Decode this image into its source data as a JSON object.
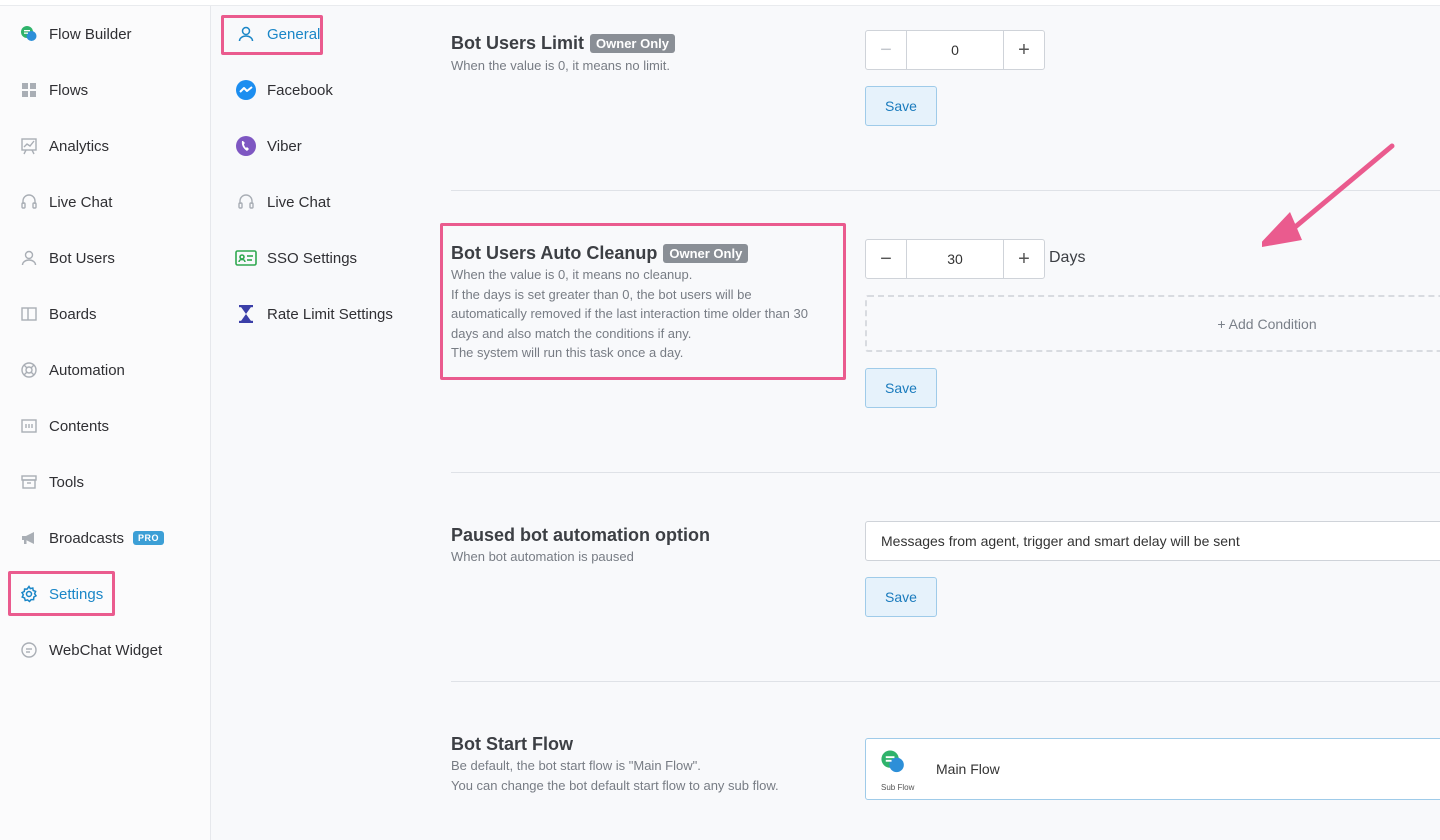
{
  "sidebar": {
    "items": [
      {
        "label": "Flow Builder",
        "icon": "chat-bubbles-icon"
      },
      {
        "label": "Flows",
        "icon": "grid-icon"
      },
      {
        "label": "Analytics",
        "icon": "presentation-chart-icon"
      },
      {
        "label": "Live Chat",
        "icon": "headset-icon"
      },
      {
        "label": "Bot Users",
        "icon": "user-icon"
      },
      {
        "label": "Boards",
        "icon": "board-icon"
      },
      {
        "label": "Automation",
        "icon": "lifebuoy-icon"
      },
      {
        "label": "Contents",
        "icon": "contents-icon"
      },
      {
        "label": "Tools",
        "icon": "archive-box-icon"
      },
      {
        "label": "Broadcasts",
        "icon": "megaphone-icon",
        "badge": "PRO"
      },
      {
        "label": "Settings",
        "icon": "gear-icon"
      },
      {
        "label": "WebChat Widget",
        "icon": "chat-icon"
      }
    ],
    "active": "Settings"
  },
  "subnav": {
    "items": [
      {
        "label": "General",
        "icon": "user-icon"
      },
      {
        "label": "Facebook",
        "icon": "messenger-icon"
      },
      {
        "label": "Viber",
        "icon": "viber-icon"
      },
      {
        "label": "Live Chat",
        "icon": "headset-icon"
      },
      {
        "label": "SSO Settings",
        "icon": "id-card-icon"
      },
      {
        "label": "Rate Limit Settings",
        "icon": "hourglass-icon"
      }
    ],
    "active": "General"
  },
  "sections": {
    "users_limit": {
      "title": "Bot Users Limit",
      "badge": "Owner Only",
      "desc": "When the value is 0, it means no limit.",
      "value": "0",
      "save": "Save"
    },
    "auto_cleanup": {
      "title": "Bot Users Auto Cleanup",
      "badge": "Owner Only",
      "desc_lines": [
        "When the value is 0, it means no cleanup.",
        "If the days is set greater than 0, the bot users will be",
        "automatically removed if the last interaction time older than 30",
        "days and also match the conditions if any.",
        "The system will run this task once a day."
      ],
      "value": "30",
      "unit": "Days",
      "add_condition": "+ Add Condition",
      "save": "Save"
    },
    "paused": {
      "title": "Paused bot automation option",
      "desc": "When bot automation is paused",
      "selected": "Messages from agent, trigger and smart delay will be sent",
      "save": "Save"
    },
    "start_flow": {
      "title": "Bot Start Flow",
      "desc_lines": [
        "Be default, the bot start flow is \"Main Flow\".",
        "You can change the bot default start flow to any sub flow."
      ],
      "flow_sub": "Sub Flow",
      "flow_name": "Main Flow"
    }
  },
  "colors": {
    "accent": "#1a86c7",
    "highlight": "#ea5b8e"
  }
}
